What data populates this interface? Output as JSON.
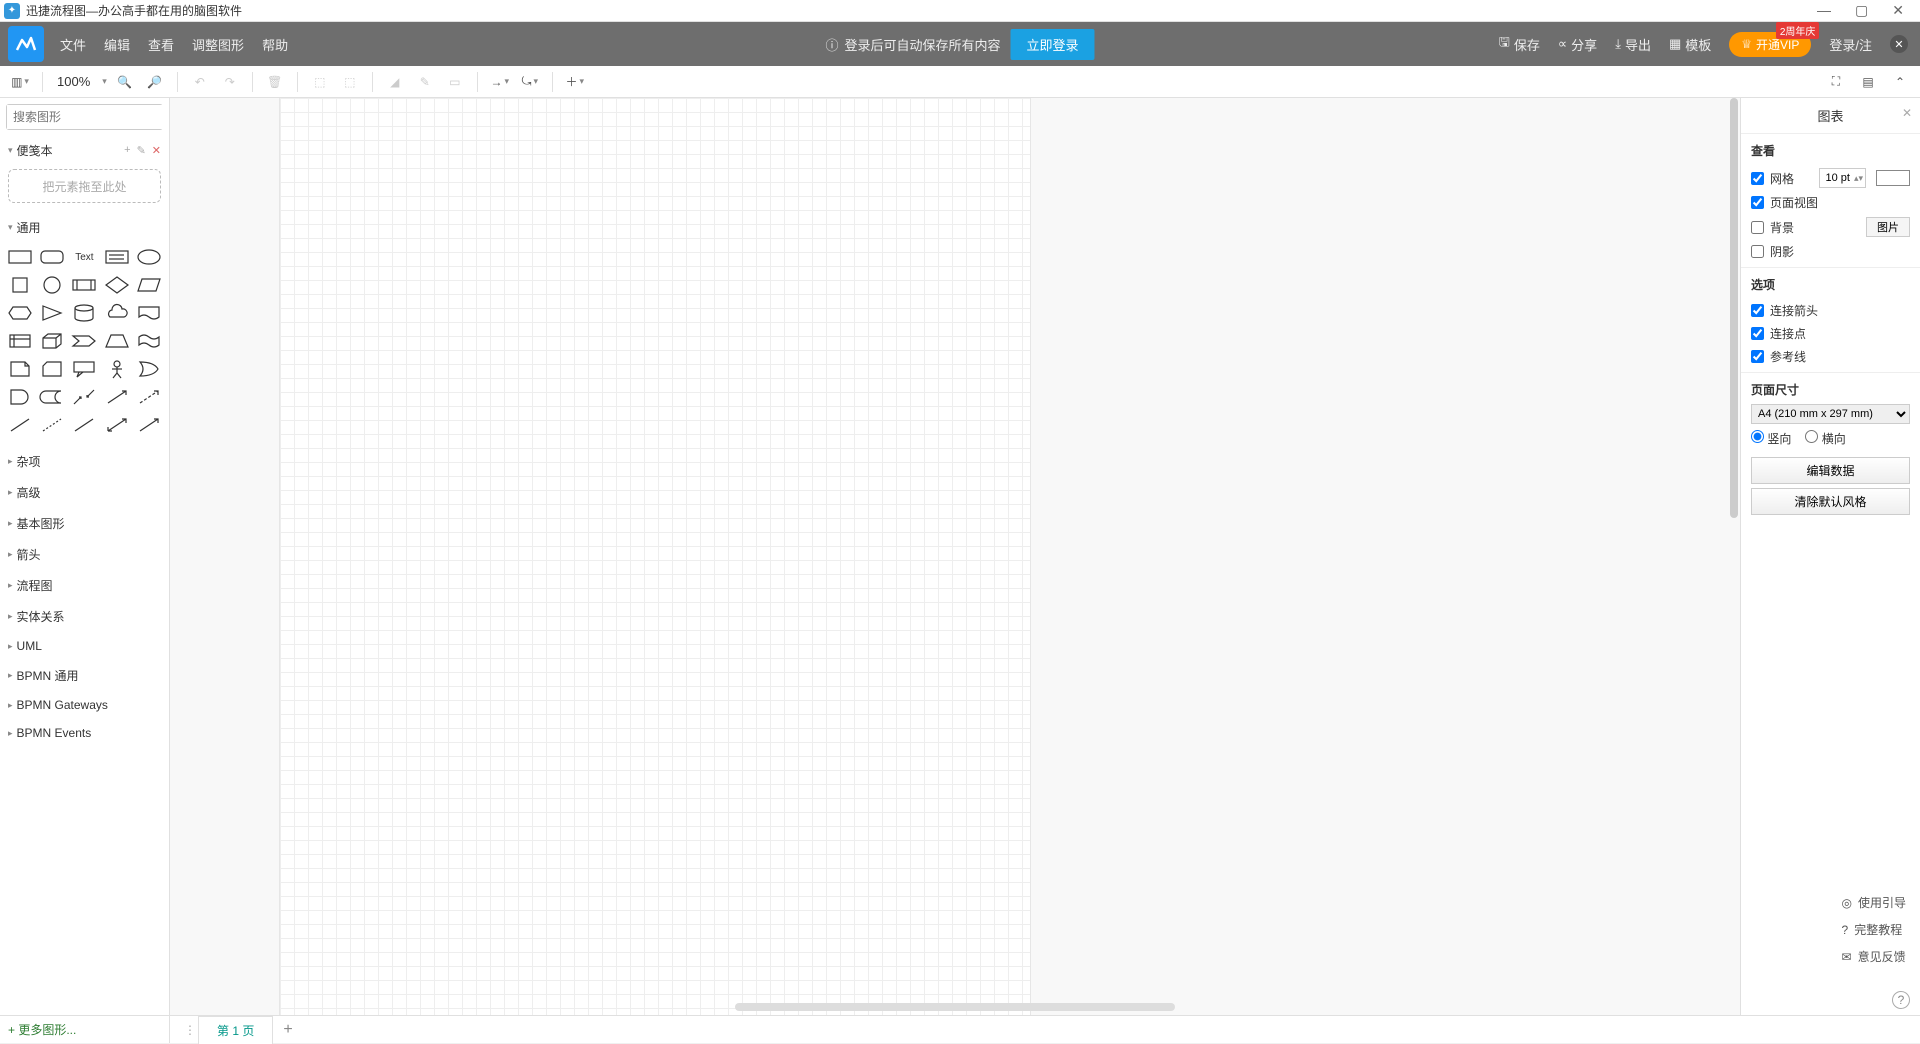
{
  "titlebar": {
    "title": "迅捷流程图—办公高手都在用的脑图软件"
  },
  "header": {
    "menu": [
      "文件",
      "编辑",
      "查看",
      "调整图形",
      "帮助"
    ],
    "notice": "登录后可自动保存所有内容",
    "login_btn": "立即登录",
    "actions": {
      "save": "保存",
      "share": "分享",
      "export": "导出",
      "template": "模板"
    },
    "vip": "开通VIP",
    "vip_badge": "2周年庆",
    "login_link": "登录/注"
  },
  "toolbar": {
    "zoom": "100%"
  },
  "left": {
    "search_placeholder": "搜索图形",
    "scratchpad": "便笺本",
    "scratchpad_hint": "把元素拖至此处",
    "general": "通用",
    "text_label": "Text",
    "categories": [
      "杂项",
      "高级",
      "基本图形",
      "箭头",
      "流程图",
      "实体关系",
      "UML",
      "BPMN 通用",
      "BPMN Gateways",
      "BPMN Events"
    ],
    "more_shapes": "+ 更多图形..."
  },
  "right": {
    "title": "图表",
    "view": "查看",
    "grid": "网格",
    "grid_size": "10 pt",
    "page_view": "页面视图",
    "background": "背景",
    "image_btn": "图片",
    "shadow": "阴影",
    "options": "选项",
    "conn_arrows": "连接箭头",
    "conn_points": "连接点",
    "guides": "参考线",
    "page_size": "页面尺寸",
    "page_size_value": "A4 (210 mm x 297 mm)",
    "portrait": "竖向",
    "landscape": "横向",
    "edit_data": "编辑数据",
    "clear_style": "清除默认风格"
  },
  "help": {
    "guide": "使用引导",
    "tutorial": "完整教程",
    "feedback": "意见反馈"
  },
  "footer": {
    "page1": "第 1 页"
  }
}
